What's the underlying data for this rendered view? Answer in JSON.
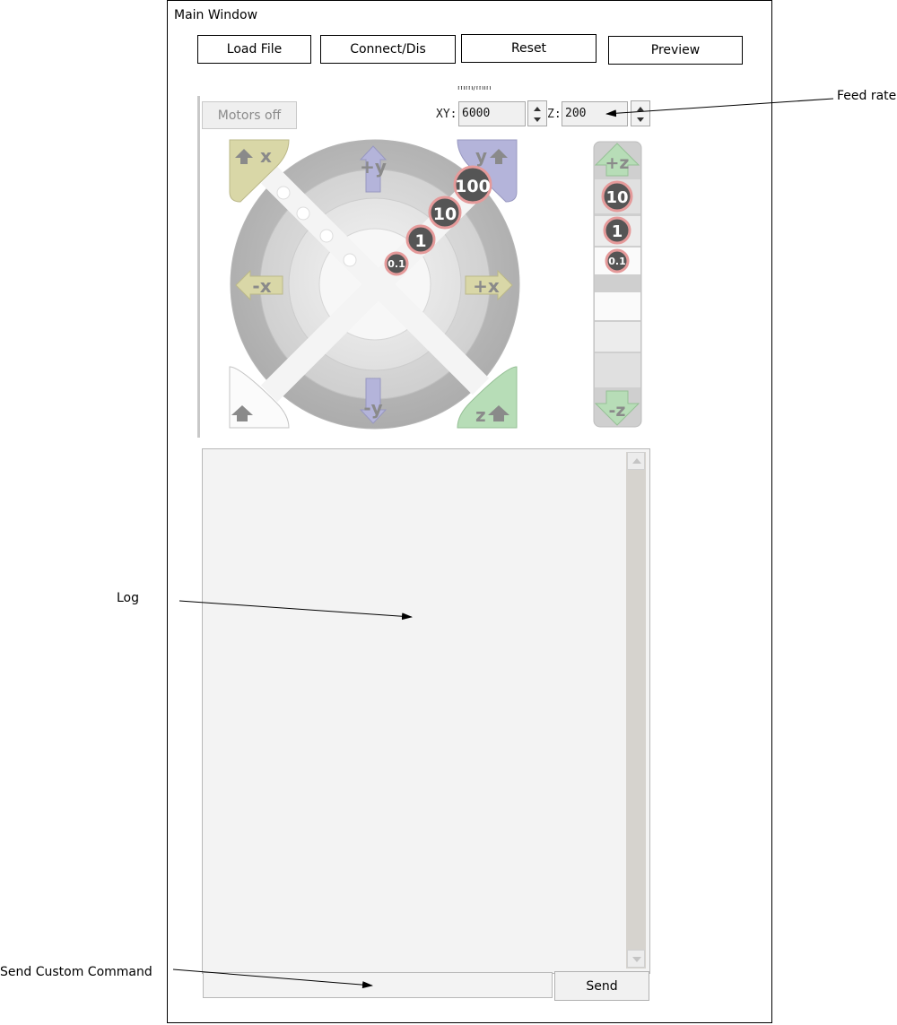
{
  "window": {
    "title": "Main Window"
  },
  "toolbar": {
    "load_file": "Load File",
    "connect": "Connect/Dis",
    "reset": "Reset",
    "preview": "Preview"
  },
  "controls": {
    "motors_off": "Motors off",
    "feed_unit": "mm/min",
    "xy_label": "XY:",
    "xy_value": "6000",
    "z_label": "Z:",
    "z_value": "200"
  },
  "jog": {
    "x_home": "x",
    "y_home": "y",
    "z_home": "z",
    "plus_y": "+y",
    "minus_y": "-y",
    "minus_x": "-x",
    "plus_x": "+x",
    "step_100": "100",
    "step_10": "10",
    "step_1": "1",
    "step_01": "0.1",
    "plus_z": "+z",
    "minus_z": "-z",
    "z_step_10": "10",
    "z_step_1": "1",
    "z_step_01": "0.1"
  },
  "colors": {
    "x_accent": "#d9d7a7",
    "y_accent": "#b4b4da",
    "z_accent": "#b7ddb7",
    "step_badge": "#555555",
    "step_ring": "#e59a9a"
  },
  "log": {
    "content": ""
  },
  "command": {
    "value": "",
    "send": "Send"
  },
  "annotations": {
    "feed_rate": "Feed rate",
    "log": "Log",
    "send_custom_command": "Send Custom Command"
  }
}
